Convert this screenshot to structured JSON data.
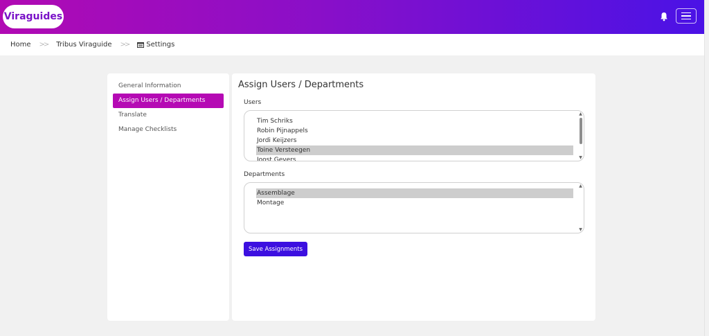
{
  "header": {
    "logo_text": "Viraguides",
    "bell_icon": "bell-icon",
    "menu_icon": "hamburger-icon",
    "gradient": [
      "#b10ab3",
      "#4a12e6"
    ]
  },
  "breadcrumb": {
    "items": [
      "Home",
      "Tribus Viraguide",
      "Settings"
    ],
    "separator": "»",
    "settings_icon": "settings-window-icon"
  },
  "sidebar": {
    "items": [
      {
        "label": "General Information",
        "active": false
      },
      {
        "label": "Assign Users / Departments",
        "active": true
      },
      {
        "label": "Translate",
        "active": false
      },
      {
        "label": "Manage Checklists",
        "active": false
      }
    ],
    "active_color": "#b50ab4"
  },
  "main": {
    "title": "Assign Users / Departments",
    "users": {
      "label": "Users",
      "options": [
        {
          "name": "Tim Schriks",
          "selected": false
        },
        {
          "name": "Robin Pijnappels",
          "selected": false
        },
        {
          "name": "Jordi Keijzers",
          "selected": false
        },
        {
          "name": "Toine Versteegen",
          "selected": true
        },
        {
          "name": "Joost Gevers",
          "selected": false
        }
      ]
    },
    "departments": {
      "label": "Departments",
      "options": [
        {
          "name": "Assemblage",
          "selected": true
        },
        {
          "name": "Montage",
          "selected": false
        }
      ]
    },
    "save_label": "Save Assignments",
    "button_color": "#3c0fe0"
  }
}
